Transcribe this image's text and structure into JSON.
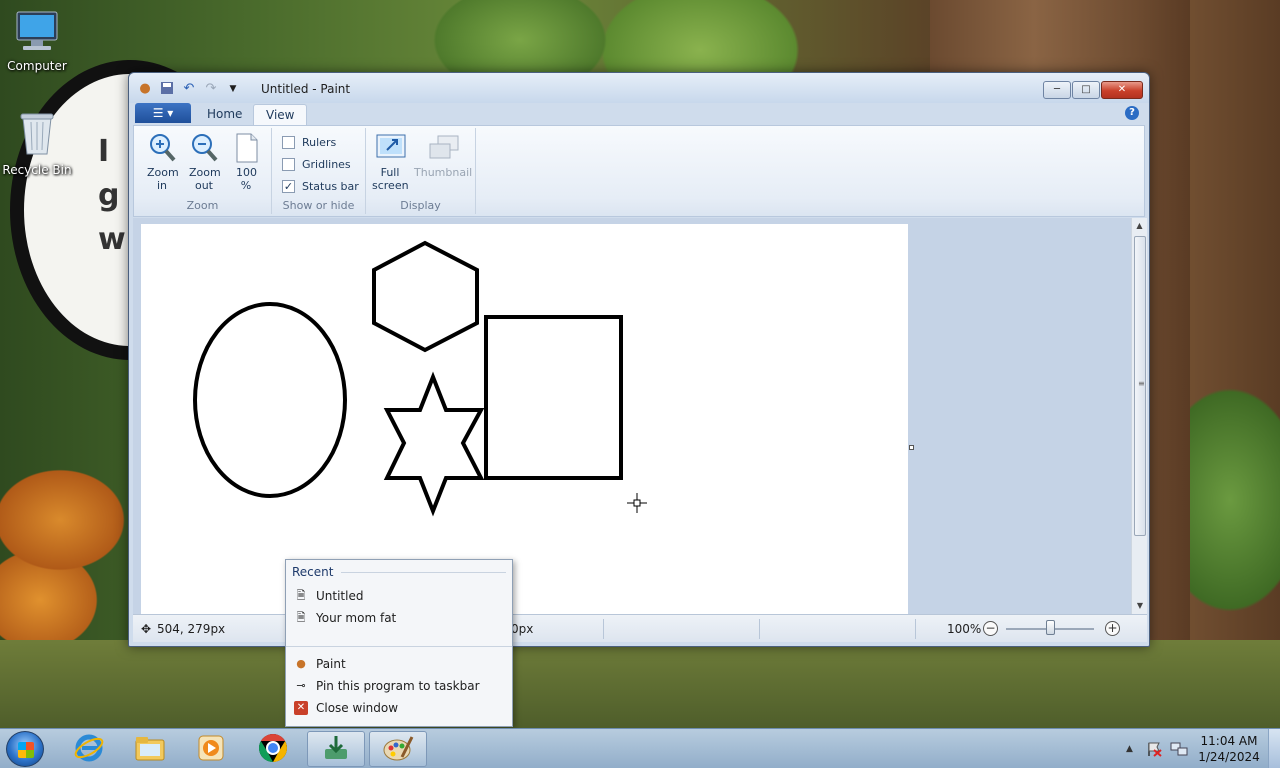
{
  "desktop": {
    "icons": [
      {
        "label": "Computer"
      },
      {
        "label": "Recycle Bin"
      }
    ],
    "sign_lines": [
      "I",
      "g",
      "w"
    ]
  },
  "paint": {
    "title": "Untitled - Paint",
    "tabs": {
      "file": "",
      "home": "Home",
      "view": "View"
    },
    "ribbon": {
      "zoom_group": {
        "label": "Zoom",
        "zoom_in": "Zoom in",
        "zoom_out": "Zoom out",
        "hundred": "100 %"
      },
      "show_hide_group": {
        "label": "Show or hide",
        "rulers": {
          "label": "Rulers",
          "checked": false
        },
        "gridlines": {
          "label": "Gridlines",
          "checked": false
        },
        "status_bar": {
          "label": "Status bar",
          "checked": true
        }
      },
      "display_group": {
        "label": "Display",
        "full_screen": "Full screen",
        "thumbnail": "Thumbnail"
      }
    },
    "canvas": {
      "shapes": [
        "ellipse",
        "hexagon",
        "rectangle",
        "six-point star"
      ]
    },
    "status": {
      "cursor_pos": "504, 279px",
      "size": "0px",
      "zoom": "100%"
    }
  },
  "jumplist": {
    "header": "Recent",
    "recent": [
      "Untitled",
      "Your mom fat"
    ],
    "tasks": [
      "Paint",
      "Pin this program to taskbar",
      "Close window"
    ]
  },
  "taskbar": {
    "pinned": [
      "Internet Explorer",
      "Windows Explorer",
      "Windows Media Player",
      "Google Chrome",
      "Download",
      "Paint"
    ],
    "time": "11:04 AM",
    "date": "1/24/2024"
  }
}
